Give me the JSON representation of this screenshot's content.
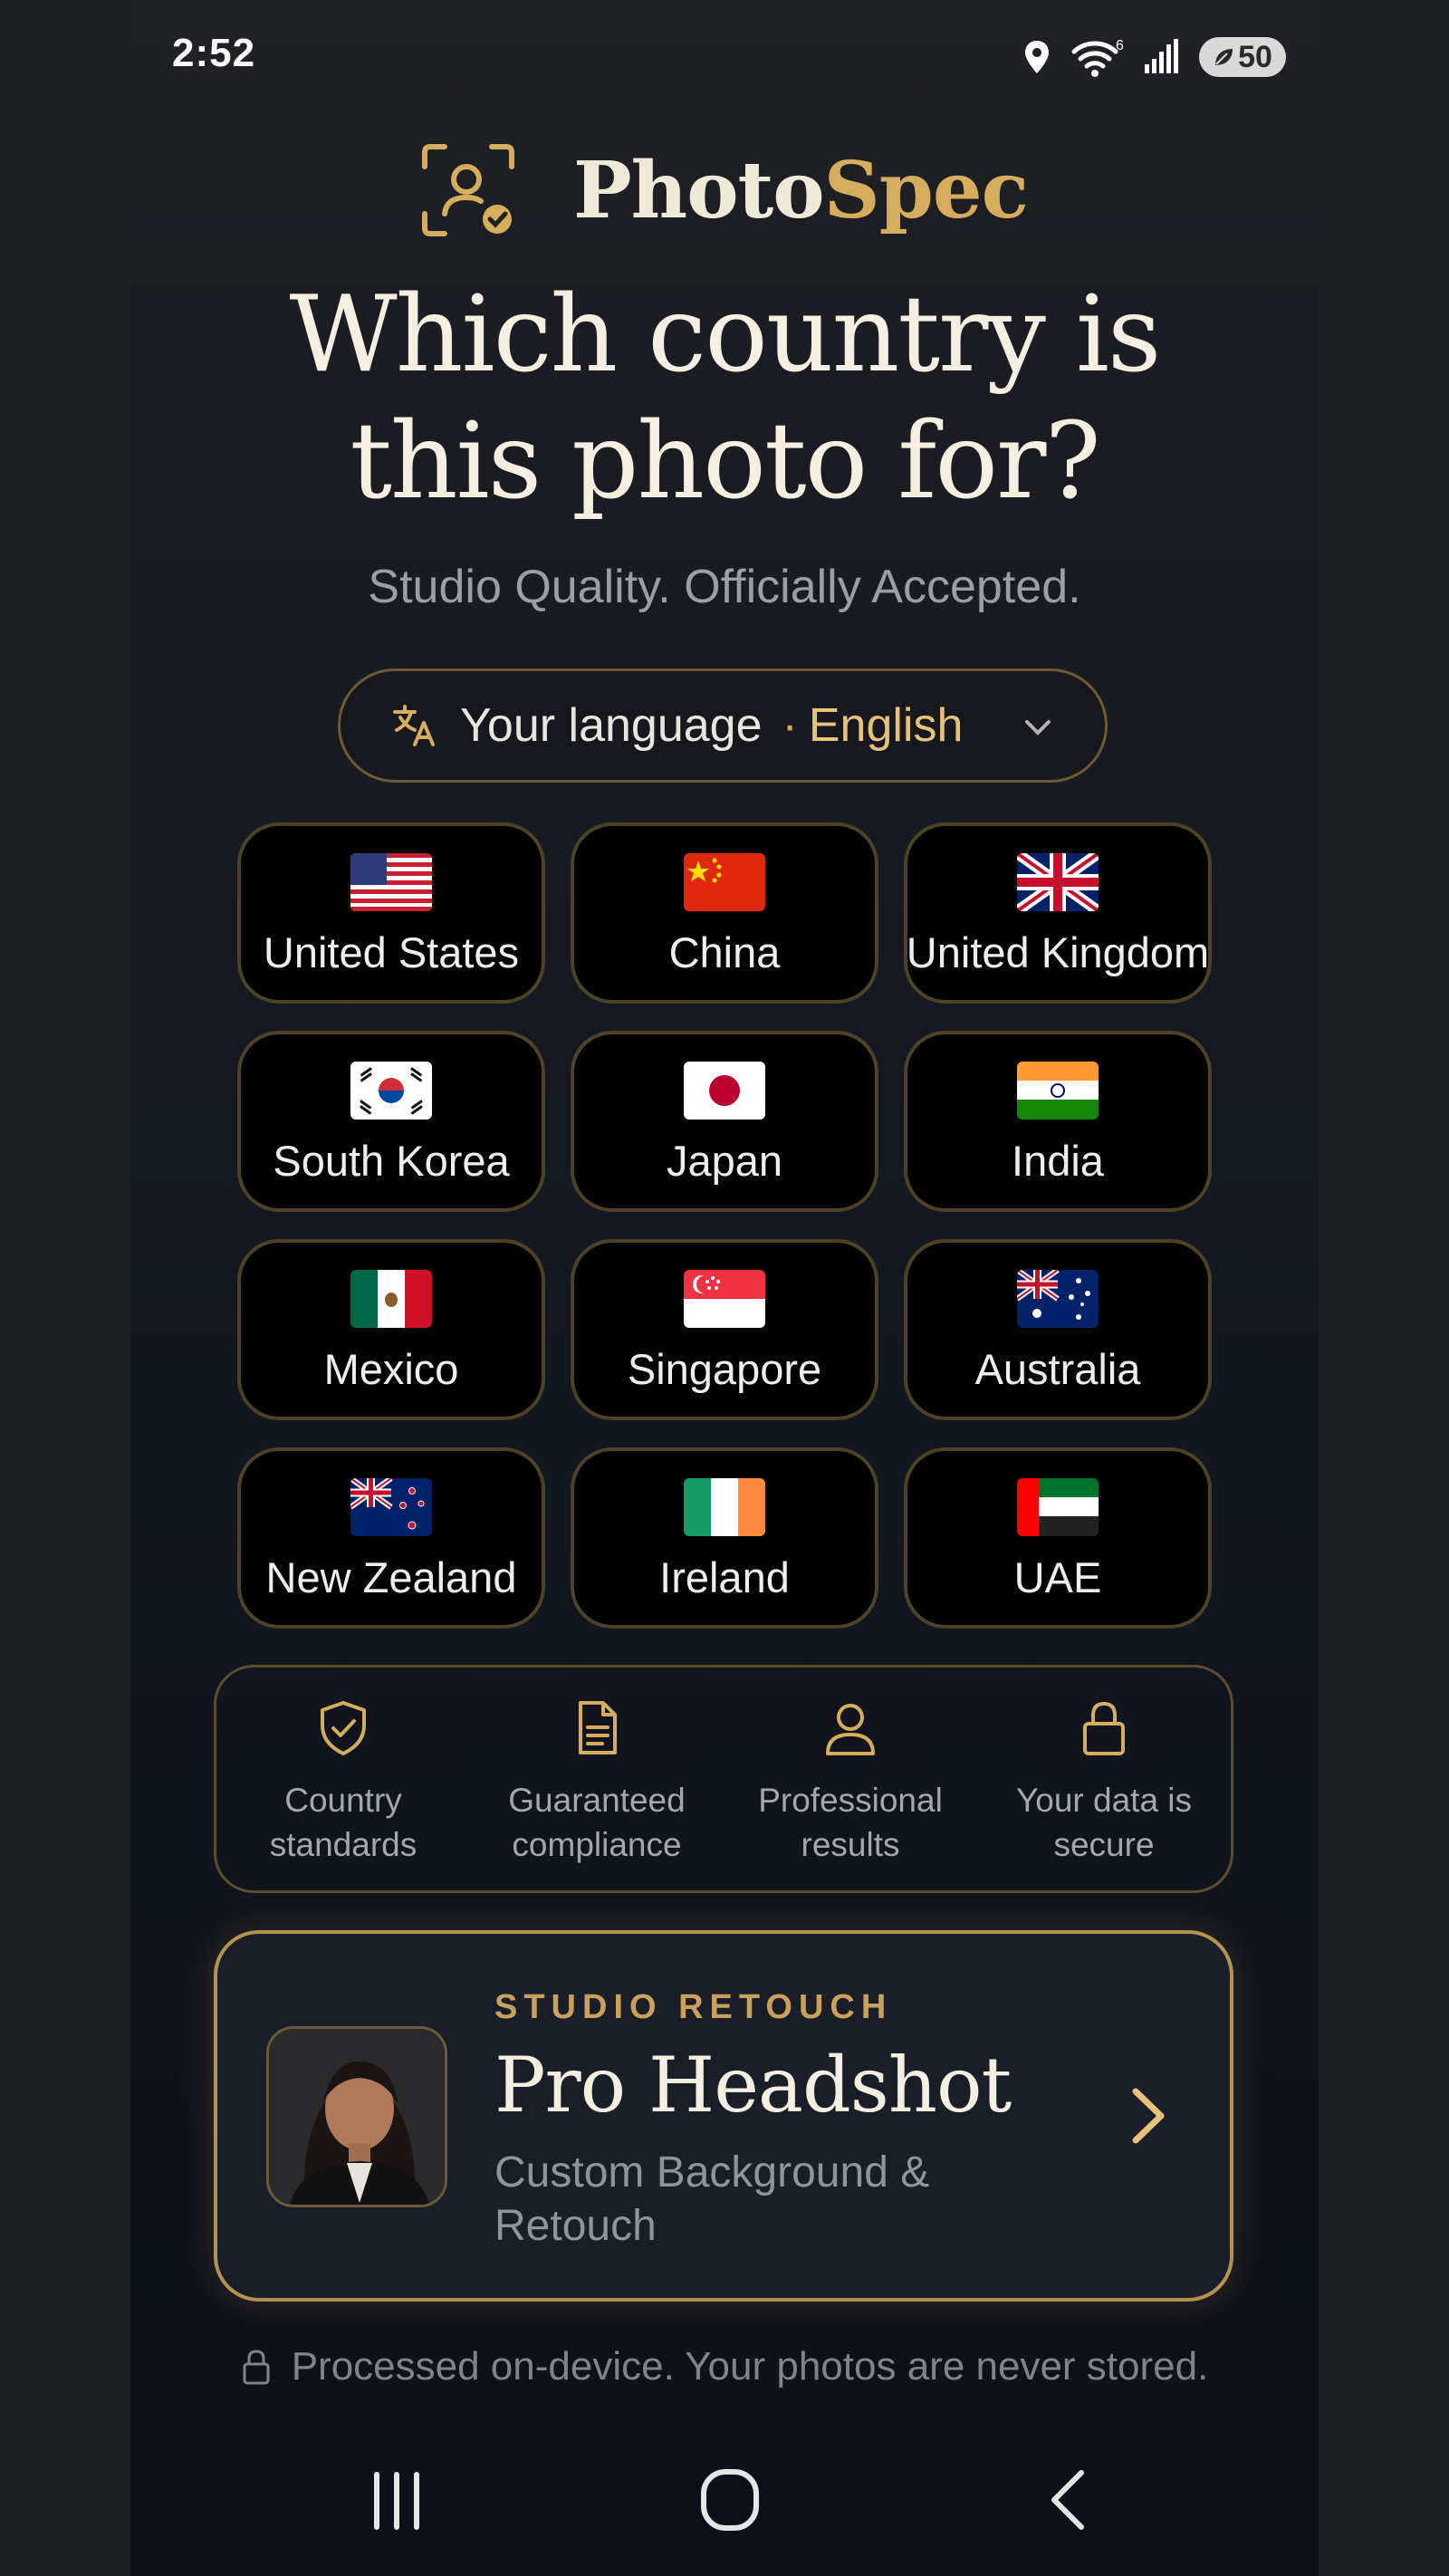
{
  "status_bar": {
    "time": "2:52",
    "battery": "50",
    "wifi_badge": "6"
  },
  "brand": {
    "name_part1": "Photo",
    "name_part2": "Spec",
    "accent_color": "#d6ad5c"
  },
  "headline": {
    "line1": "Which country is",
    "line2": "this photo for?"
  },
  "subtitle": "Studio Quality. Officially Accepted.",
  "language_selector": {
    "label": "Your language",
    "separator": "·",
    "value": "English"
  },
  "countries": [
    {
      "name": "United States",
      "flag": "us-flag"
    },
    {
      "name": "China",
      "flag": "cn-flag"
    },
    {
      "name": "United Kingdom",
      "flag": "gb-flag"
    },
    {
      "name": "South Korea",
      "flag": "kr-flag"
    },
    {
      "name": "Japan",
      "flag": "jp-flag"
    },
    {
      "name": "India",
      "flag": "in-flag"
    },
    {
      "name": "Mexico",
      "flag": "mx-flag"
    },
    {
      "name": "Singapore",
      "flag": "sg-flag"
    },
    {
      "name": "Australia",
      "flag": "au-flag"
    },
    {
      "name": "New Zealand",
      "flag": "nz-flag"
    },
    {
      "name": "Ireland",
      "flag": "ie-flag"
    },
    {
      "name": "UAE",
      "flag": "ae-flag"
    }
  ],
  "features": [
    {
      "line1": "Country",
      "line2": "standards",
      "icon": "shield-check-icon"
    },
    {
      "line1": "Guaranteed",
      "line2": "compliance",
      "icon": "document-icon"
    },
    {
      "line1": "Professional",
      "line2": "results",
      "icon": "person-icon"
    },
    {
      "line1": "Your data is",
      "line2": "secure",
      "icon": "lock-icon"
    }
  ],
  "promo": {
    "eyebrow": "STUDIO RETOUCH",
    "title": "Pro Headshot",
    "subtitle": "Custom Background & Retouch"
  },
  "footer_note": "Processed on-device. Your photos are never stored."
}
